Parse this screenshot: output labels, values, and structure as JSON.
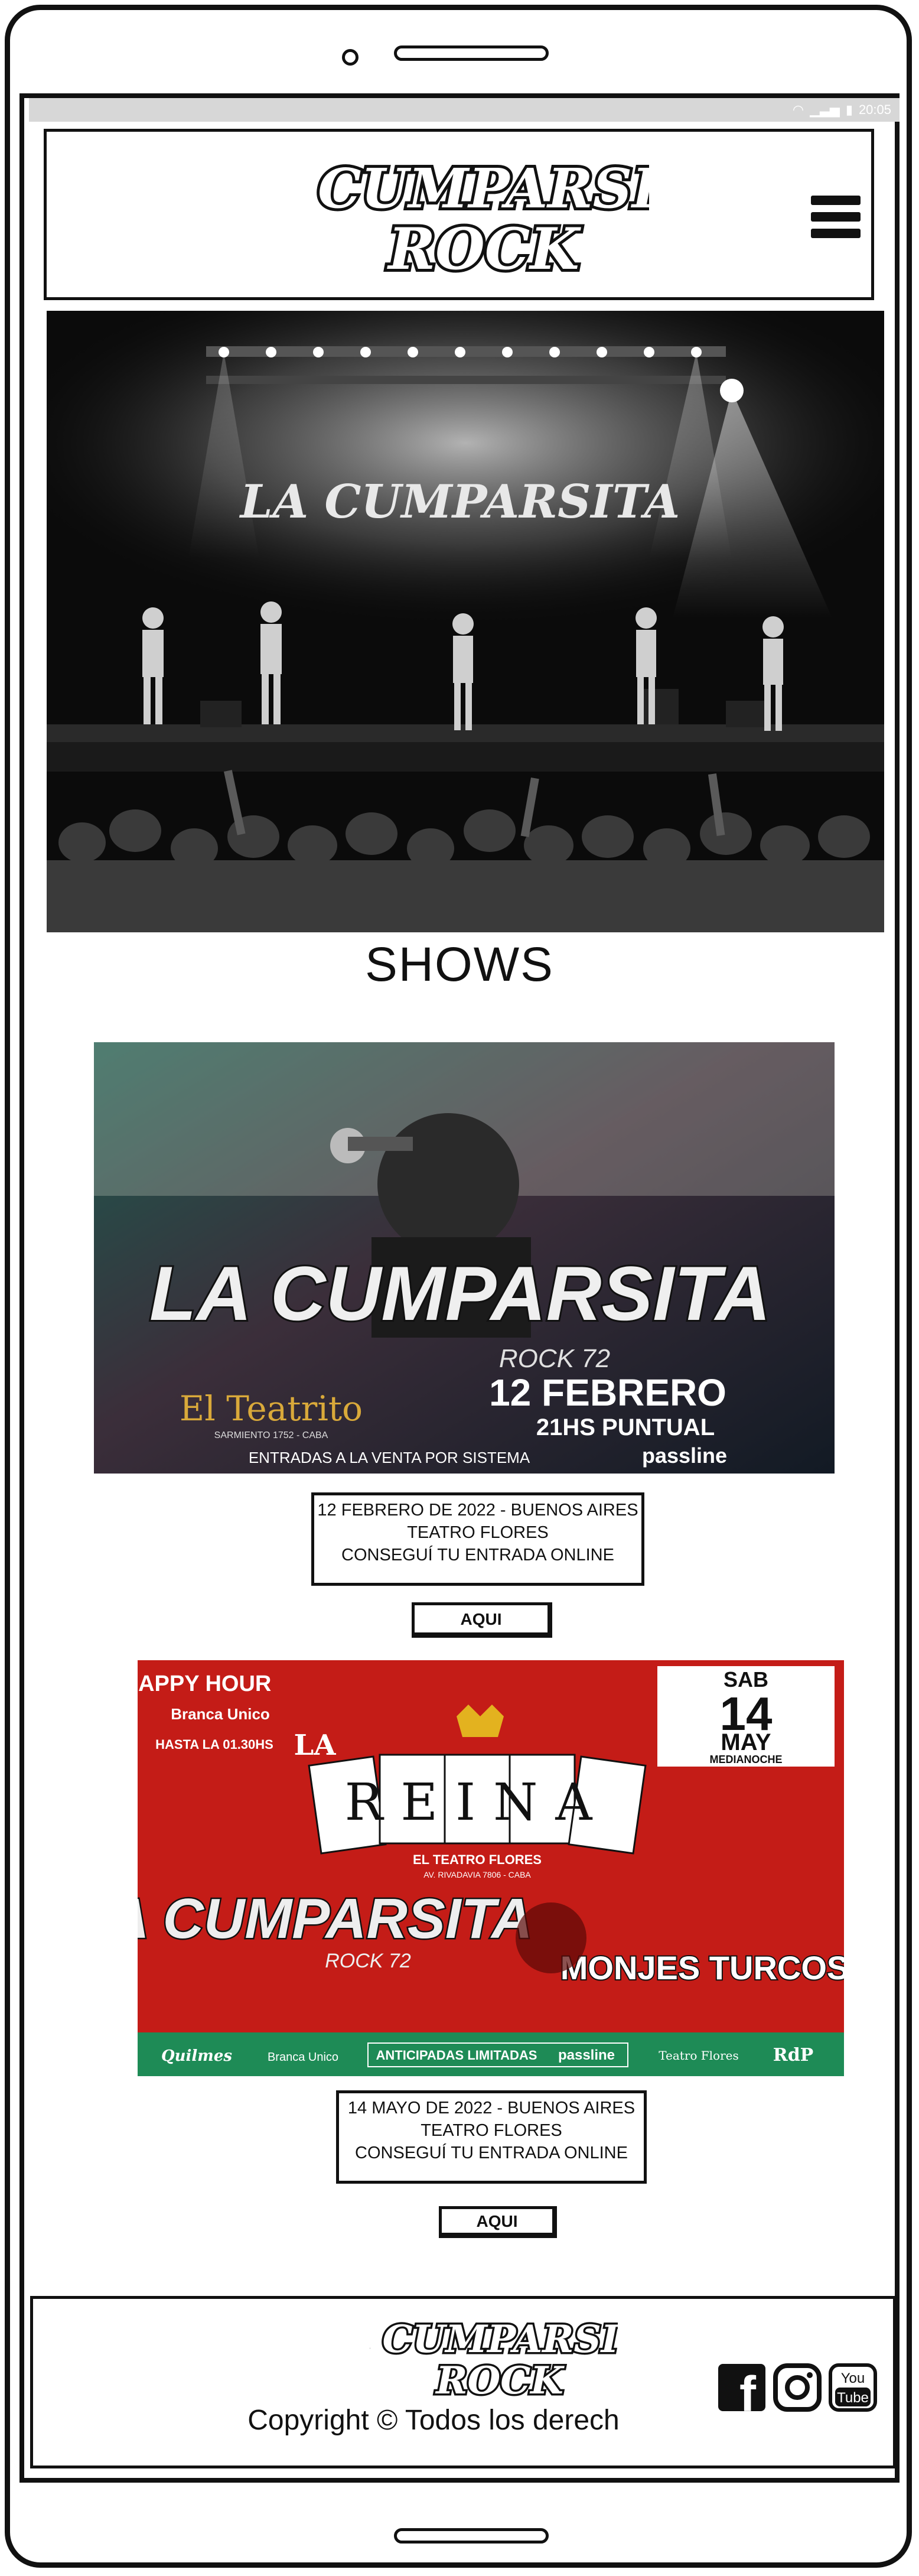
{
  "status_bar": {
    "time": "20:05"
  },
  "brand": {
    "logo_line1": "LA CUMPARSITA",
    "logo_line2": "ROCK",
    "hero_banner": "LA CUMPARSITA"
  },
  "shows": {
    "title": "SHOWS",
    "items": [
      {
        "poster": {
          "band": "LA CUMPARSITA",
          "subtitle": "ROCK 72",
          "venue": "El Teatrito",
          "address": "SARMIENTO 1752 - CABA",
          "date": "12 FEBRERO",
          "time": "21HS PUNTUAL",
          "sales": "ENTRADAS A LA VENTA POR SISTEMA",
          "ticketing": "passline"
        },
        "line1": "12 FEBRERO DE 2022 - BUENOS AIRES",
        "line2": "TEATRO FLORES",
        "line3": "CONSEGUÍ TU ENTRADA ONLINE",
        "button": "AQUI"
      },
      {
        "poster": {
          "happy": "HAPPY HOUR",
          "brand": "Branca Unico",
          "until": "HASTA LA 01.30HS",
          "day": "SAB",
          "num": "14",
          "month": "MAY",
          "late": "MEDIANOCHE",
          "event": "REINA",
          "la": "LA",
          "venue": "EL TEATRO FLORES",
          "venue_addr": "AV. RIVADAVIA 7806 - CABA",
          "band": "LA CUMPARSITA",
          "subtitle": "ROCK 72",
          "guest": "MONJES TURCOS",
          "sponsor1": "Quilmes",
          "sponsor2": "Branca Unico",
          "presale": "ANTICIPADAS LIMITADAS",
          "ticketing": "passline",
          "sponsor3": "Teatro Flores",
          "sponsor4": "RdP"
        },
        "line1": "14 MAYO DE 2022 - BUENOS AIRES",
        "line2": "TEATRO FLORES",
        "line3": "CONSEGUÍ TU ENTRADA ONLINE",
        "button": "AQUI"
      }
    ]
  },
  "footer": {
    "copyright": "Copyright © Todos los derech",
    "social": [
      {
        "icon": "facebook-icon",
        "label": "f"
      },
      {
        "icon": "instagram-icon",
        "label": ""
      },
      {
        "icon": "youtube-icon",
        "label_top": "You",
        "label_bottom": "Tube"
      }
    ]
  }
}
